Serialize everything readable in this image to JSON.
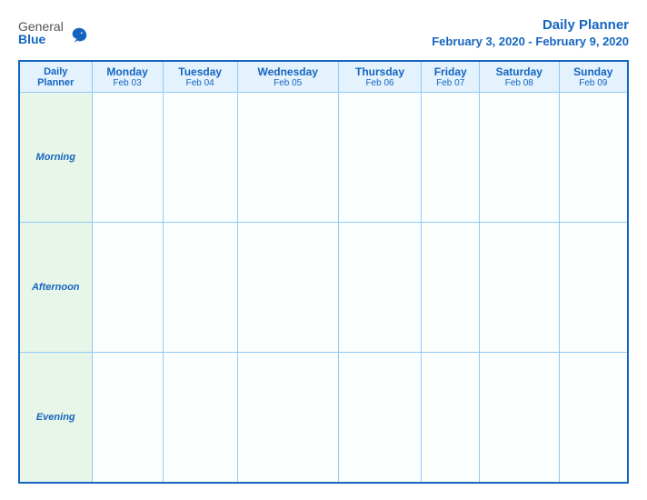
{
  "header": {
    "logo_general": "General",
    "logo_blue": "Blue",
    "title": "Daily Planner",
    "subtitle": "February 3, 2020 - February 9, 2020"
  },
  "table": {
    "header_row": [
      {
        "day": "Daily",
        "day2": "Planner",
        "date": ""
      },
      {
        "day": "Monday",
        "date": "Feb 03"
      },
      {
        "day": "Tuesday",
        "date": "Feb 04"
      },
      {
        "day": "Wednesday",
        "date": "Feb 05"
      },
      {
        "day": "Thursday",
        "date": "Feb 06"
      },
      {
        "day": "Friday",
        "date": "Feb 07"
      },
      {
        "day": "Saturday",
        "date": "Feb 08"
      },
      {
        "day": "Sunday",
        "date": "Feb 09"
      }
    ],
    "rows": [
      {
        "label": "Morning"
      },
      {
        "label": "Afternoon"
      },
      {
        "label": "Evening"
      }
    ]
  }
}
